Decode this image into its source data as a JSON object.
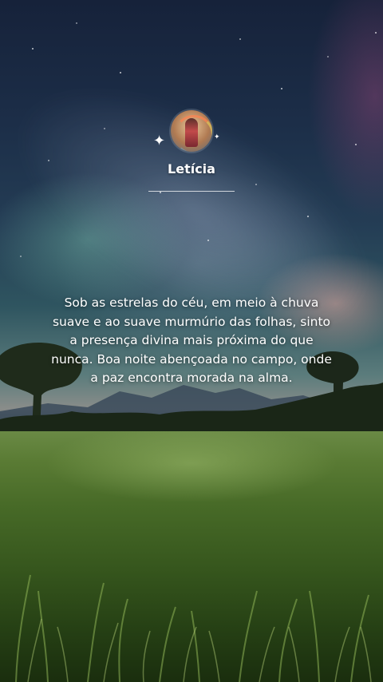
{
  "background": {
    "description_icon": "night-sky-field-image",
    "colors": {
      "sky_top": "#16223a",
      "horizon_glow": "#eba8a0",
      "field": "#476a27"
    }
  },
  "profile": {
    "avatar_icon": "user-avatar",
    "sparkle_left_glyph": "✦",
    "sparkle_right_glyph": "✦",
    "name": "Letícia"
  },
  "quote": {
    "text": "Sob as estrelas do céu, em meio à chuva suave e ao suave murmúrio das folhas, sinto a presença divina mais próxima do que nunca. Boa noite abençoada no campo, onde a paz encontra morada na alma."
  }
}
